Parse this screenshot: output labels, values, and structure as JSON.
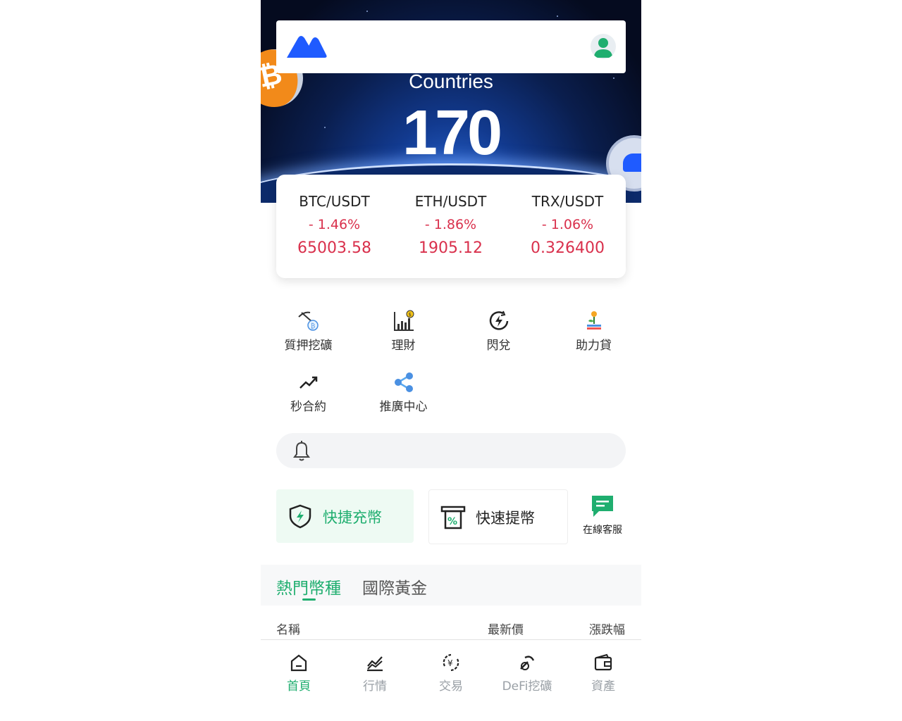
{
  "banner": {
    "title": "Countries",
    "number": "170"
  },
  "ticker": [
    {
      "pair": "BTC/USDT",
      "change": "- 1.46%",
      "price": "65003.58"
    },
    {
      "pair": "ETH/USDT",
      "change": "- 1.86%",
      "price": "1905.12"
    },
    {
      "pair": "TRX/USDT",
      "change": "- 1.06%",
      "price": "0.326400"
    }
  ],
  "menu": [
    {
      "label": "質押挖礦",
      "icon": "mining-icon"
    },
    {
      "label": "理財",
      "icon": "finance-chart-icon"
    },
    {
      "label": "閃兌",
      "icon": "flash-exchange-icon"
    },
    {
      "label": "助力貸",
      "icon": "loan-plant-icon"
    },
    {
      "label": "秒合約",
      "icon": "trend-up-icon"
    },
    {
      "label": "推廣中心",
      "icon": "share-icon"
    }
  ],
  "quick_actions": {
    "deposit": "快捷充幣",
    "withdraw": "快速提幣",
    "support": "在線客服"
  },
  "tabs": [
    {
      "label": "熱門幣種",
      "active": true
    },
    {
      "label": "國際黃金",
      "active": false
    }
  ],
  "table_headers": {
    "name": "名稱",
    "price": "最新價",
    "change": "漲跌幅"
  },
  "bottom_nav": [
    {
      "label": "首頁",
      "icon": "home-icon",
      "active": true
    },
    {
      "label": "行情",
      "icon": "market-chart-icon",
      "active": false
    },
    {
      "label": "交易",
      "icon": "yuan-exchange-icon",
      "active": false
    },
    {
      "label": "DeFi挖礦",
      "icon": "pickaxe-icon",
      "active": false
    },
    {
      "label": "資產",
      "icon": "wallet-icon",
      "active": false
    }
  ],
  "colors": {
    "accent": "#1fae6f",
    "down": "#d9304c",
    "brand_blue": "#1f5bff",
    "inactive": "#9aa0a6"
  }
}
